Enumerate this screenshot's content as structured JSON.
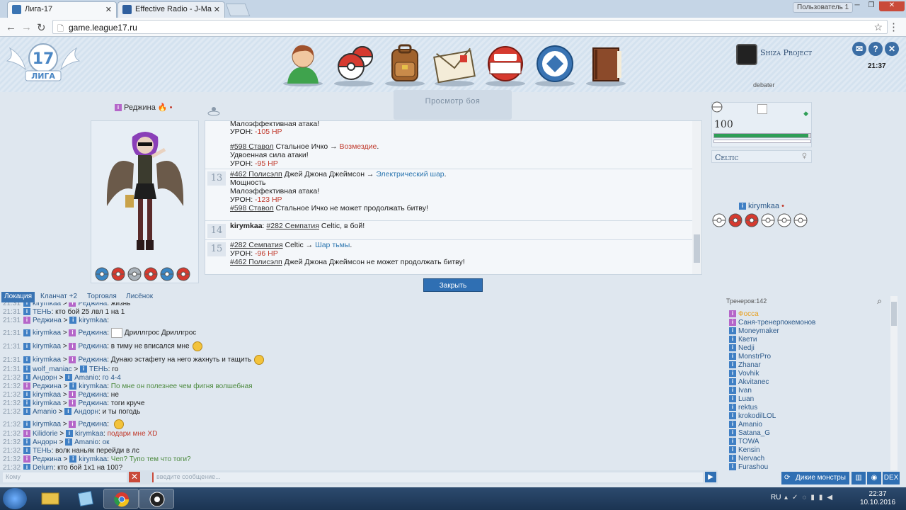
{
  "browser": {
    "tabs": [
      {
        "title": "Лига-17",
        "active": true
      },
      {
        "title": "Effective Radio - J-Ma",
        "active": false
      }
    ],
    "user_label": "Пользователь 1",
    "url": "game.league17.ru"
  },
  "header": {
    "logo_number": "17",
    "logo_text": "ЛИГА",
    "project_name": "Shiza Project",
    "project_sub": "debater",
    "clock": "21:37"
  },
  "battle": {
    "watch_label": "Просмотр боя",
    "close_label": "Закрыть",
    "player": {
      "name": "Реджина",
      "balls": [
        "blue",
        "red",
        "gray",
        "red",
        "blue",
        "red"
      ]
    },
    "opponent": {
      "hp": "100",
      "hp_fraction": 0.98,
      "pokemon": "Celtic",
      "trainer": "kirymkaa",
      "balls": [
        "white",
        "red",
        "red",
        "white",
        "white",
        "white"
      ]
    },
    "log": [
      {
        "turn": "",
        "lines": [
          {
            "html": "Малоэффективная атака!"
          },
          {
            "html": "УРОН: <span class='red'>-105 HP</span>"
          },
          {
            "html": ""
          },
          {
            "html": "<span class='u'>#598 Ставол</span> Стальное Ичко → <span class='red'>Возмездие</span>."
          },
          {
            "html": "Удвоенная сила атаки!"
          },
          {
            "html": "УРОН: <span class='red'>-95 HP</span>"
          }
        ]
      },
      {
        "turn": "13",
        "lines": [
          {
            "html": "<span class='u'>#462 Полисэлп</span> Джей Джона Джеймсон → <span class='blu'>Электрический шар</span>."
          },
          {
            "html": "Мощность"
          },
          {
            "html": "Малоэффективная атака!"
          },
          {
            "html": "УРОН: <span class='red'>-123 HP</span>"
          },
          {
            "html": "<span class='u'>#598 Ставол</span> Стальное Ичко не может продолжать битву!"
          }
        ]
      },
      {
        "turn": "14",
        "lines": [
          {
            "html": "<b>kirymkaa</b>: <span class='u'>#282 Семпатия</span> Celtic, в бой!"
          }
        ]
      },
      {
        "turn": "15",
        "lines": [
          {
            "html": "<span class='u'>#282 Семпатия</span> Celtic → <span class='blu'>Шар тьмы</span>."
          },
          {
            "html": "УРОН: <span class='red'>-96 HP</span>"
          },
          {
            "html": "<span class='u'>#462 Полисэлп</span> Джей Джона Джеймсон не может продолжать битву!"
          }
        ]
      }
    ]
  },
  "chat": {
    "tabs": [
      "Локация",
      "Кланчат +2",
      "Торговля",
      "Лисёнок"
    ],
    "input_to_placeholder": "Кому",
    "input_placeholder": "введите сообщение...",
    "messages": [
      {
        "time": "21:31",
        "from": "kirymkaa",
        "to": "Реджина",
        "text": "жизнь",
        "color": ""
      },
      {
        "time": "21:31",
        "from": "ТЕНЬ",
        "to": "",
        "text": "кто бой 25 лвл 1 на 1",
        "color": ""
      },
      {
        "time": "21:31",
        "from": "Реджина",
        "to": "kirymkaa",
        "text": "",
        "color": ""
      },
      {
        "time": "21:31",
        "from": "kirymkaa",
        "to": "Реджина",
        "text": "Дриллгрос Дриллгрос",
        "color": "",
        "img": true
      },
      {
        "time": "21:31",
        "from": "kirymkaa",
        "to": "Реджина",
        "text": "в тиму не вписался мне",
        "color": "",
        "smile": true
      },
      {
        "time": "21:31",
        "from": "kirymkaa",
        "to": "Реджина",
        "text": "Дунаю эстафету на него жахнуть и тащить",
        "color": "",
        "smile": true
      },
      {
        "time": "21:31",
        "from": "wolf_maniac",
        "to": "ТЕНЬ",
        "text": "го",
        "color": ""
      },
      {
        "time": "21:32",
        "from": "Андорн",
        "to": "Amanio",
        "text": "го 4-4",
        "color": "nm"
      },
      {
        "time": "21:32",
        "from": "Реджина",
        "to": "kirymkaa",
        "text": "По мне он полезнее чем фигня волшебная",
        "color": "gr"
      },
      {
        "time": "21:32",
        "from": "kirymkaa",
        "to": "Реджина",
        "text": "не",
        "color": ""
      },
      {
        "time": "21:32",
        "from": "kirymkaa",
        "to": "Реджина",
        "text": "тоги круче",
        "color": ""
      },
      {
        "time": "21:32",
        "from": "Amanio",
        "to": "Андорн",
        "text": "и ты погодь",
        "color": ""
      },
      {
        "time": "21:32",
        "from": "kirymkaa",
        "to": "Реджина",
        "text": "",
        "color": "",
        "smile": true
      },
      {
        "time": "21:32",
        "from": "Kilidorie",
        "to": "kirymkaa",
        "text": "подари мне XD",
        "color": "rd"
      },
      {
        "time": "21:32",
        "from": "Андорн",
        "to": "Amanio",
        "text": "ок",
        "color": "nm"
      },
      {
        "time": "21:32",
        "from": "ТЕНЬ",
        "to": "",
        "text": "волк наньяк перейди в лс",
        "color": ""
      },
      {
        "time": "21:32",
        "from": "Реджина",
        "to": "kirymkaa",
        "text": "Чеп? Тупо тем что тоги?",
        "color": "gr"
      },
      {
        "time": "21:32",
        "from": "Delurn",
        "to": "",
        "text": "кто бой 1х1 на 100?",
        "color": ""
      }
    ]
  },
  "online": {
    "title": "Тренеров:142",
    "users": [
      "Фосса",
      "Саня-тренерпокемонов",
      "Moneymaker",
      "Квети",
      "Nedji",
      "MonstrPro",
      "Zhanar",
      "Vovhik",
      "Akvitanec",
      "Ivan",
      "Luan",
      "rektus",
      "krokodilLOL",
      "Amanio",
      "Satana_G",
      "TOWA",
      "Kensin",
      "Nervach",
      "Furashou"
    ],
    "wild_label": "Дикие монстры",
    "dex_label": "DEX"
  },
  "taskbar": {
    "lang": "RU",
    "time": "22:37",
    "date": "10.10.2016"
  },
  "colors": {
    "accent": "#2f6fb3",
    "hp": "#2f9e57",
    "danger": "#c94a3a"
  }
}
